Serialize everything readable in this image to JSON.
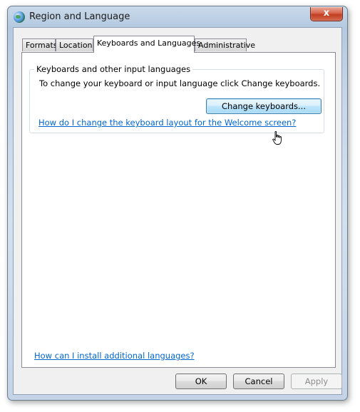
{
  "window": {
    "title": "Region and Language",
    "close_glyph": "x",
    "icon": "globe-icon"
  },
  "tabs": [
    {
      "label": "Formats",
      "active": false
    },
    {
      "label": "Location",
      "active": false
    },
    {
      "label": "Keyboards and Languages",
      "active": true
    },
    {
      "label": "Administrative",
      "active": false
    }
  ],
  "keyboards_group": {
    "title": "Keyboards and other input languages",
    "description": "To change your keyboard or input language click Change keyboards.",
    "change_button": "Change keyboards...",
    "welcome_link": "How do I change the keyboard layout for the Welcome screen?"
  },
  "install_link": "How can I install additional languages?",
  "footer": {
    "ok": "OK",
    "cancel": "Cancel",
    "apply": "Apply"
  },
  "colors": {
    "link": "#0066cc",
    "close_button": "#c13d22",
    "focus_border": "#3c7fb1"
  }
}
